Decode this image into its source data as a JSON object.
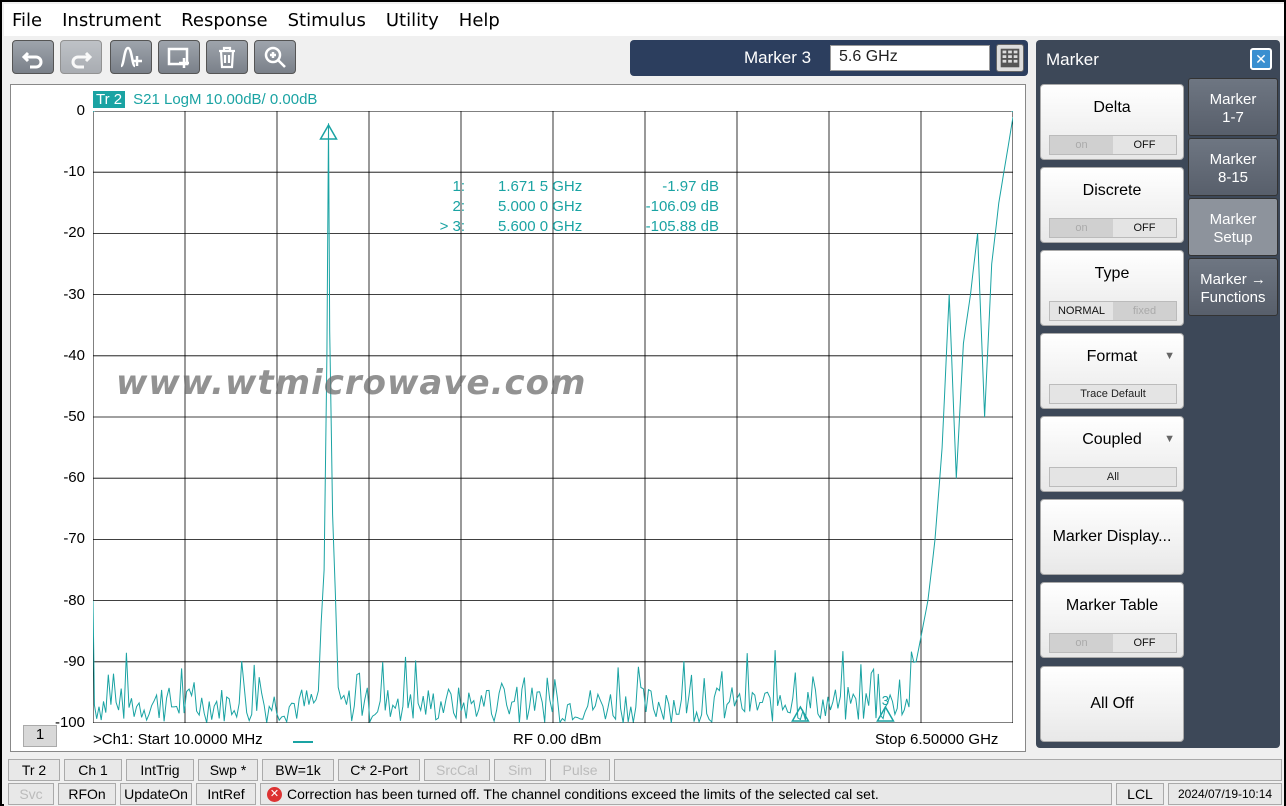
{
  "menu": [
    "File",
    "Instrument",
    "Response",
    "Stimulus",
    "Utility",
    "Help"
  ],
  "toolbar_icons": [
    "undo-icon",
    "redo-icon",
    "add-trace-icon",
    "channel-icon",
    "delete-icon",
    "zoom-icon"
  ],
  "marker_entry": {
    "label": "Marker 3",
    "value": "5.6 GHz"
  },
  "trace": {
    "name": "Tr 2",
    "desc": "S21 LogM 10.00dB/  0.00dB"
  },
  "watermark": "www.wtmicrowave.com",
  "marker_readouts": [
    {
      "id": "1:",
      "freq": "1.671 5 GHz",
      "val": "-1.97 dB"
    },
    {
      "id": "2:",
      "freq": "5.000 0 GHz",
      "val": "-106.09 dB"
    },
    {
      "id": "> 3:",
      "freq": "5.600 0 GHz",
      "val": "-105.88 dB"
    }
  ],
  "footer": {
    "channel": "1",
    "start": ">Ch1:  Start   10.0000 MHz",
    "rf": "RF    0.00 dBm",
    "stop": "Stop  6.50000 GHz"
  },
  "panel": {
    "title": "Marker",
    "buttons": [
      {
        "label": "Delta",
        "opts": [
          "on",
          "OFF"
        ]
      },
      {
        "label": "Discrete",
        "opts": [
          "on",
          "OFF"
        ]
      },
      {
        "label": "Type",
        "opts": [
          "NORMAL",
          "fixed"
        ]
      },
      {
        "label": "Format",
        "value": "Trace Default"
      },
      {
        "label": "Coupled",
        "value": "All"
      },
      {
        "label": "Marker Display..."
      },
      {
        "label": "Marker Table",
        "opts": [
          "on",
          "OFF"
        ]
      },
      {
        "label": "All Off"
      }
    ],
    "tabs": [
      "Marker\n1-7",
      "Marker\n8-15",
      "Marker\nSetup",
      "Marker →\nFunctions"
    ]
  },
  "status_row1": [
    "Tr 2",
    "Ch 1",
    "IntTrig",
    "Swp *",
    "BW=1k",
    "C* 2-Port",
    "SrcCal",
    "Sim",
    "Pulse"
  ],
  "status_row2": [
    "Svc",
    "RFOn",
    "UpdateOn",
    "IntRef"
  ],
  "status_message": "Correction has been turned off. The channel conditions exceed the limits of the selected cal set.",
  "status_right": [
    "LCL",
    "2024/07/19-10:14"
  ],
  "colors": {
    "trace": "#1aa3a3",
    "panel": "#3d4858"
  },
  "chart_data": {
    "type": "line",
    "xlabel": "",
    "ylabel": "",
    "xlim": [
      0.01,
      6.5
    ],
    "ylim": [
      -100,
      0
    ],
    "y_ticks": [
      0,
      -10,
      -20,
      -30,
      -40,
      -50,
      -60,
      -70,
      -80,
      -90,
      -100
    ],
    "grid": true,
    "series": [
      {
        "name": "S21",
        "x": [
          0.01,
          0.02,
          0.1,
          0.3,
          0.6,
          0.9,
          1.2,
          1.5,
          1.6,
          1.64,
          1.66,
          1.671,
          1.68,
          1.7,
          1.74,
          1.78,
          2.0,
          2.5,
          3.0,
          3.5,
          4.0,
          4.5,
          5.0,
          5.3,
          5.5,
          5.6,
          5.7,
          5.8,
          5.9,
          5.95,
          6.0,
          6.05,
          6.1,
          6.15,
          6.2,
          6.25,
          6.3,
          6.35,
          6.4,
          6.45,
          6.5
        ],
        "y": [
          -80,
          -96,
          -98,
          -99,
          -97,
          -99,
          -98,
          -98,
          -92,
          -75,
          -40,
          -2,
          -36,
          -66,
          -92,
          -99,
          -99,
          -98,
          -99,
          -98,
          -99,
          -98,
          -106,
          -99,
          -99,
          -106,
          -95,
          -92,
          -80,
          -70,
          -55,
          -30,
          -60,
          -38,
          -30,
          -20,
          -50,
          -25,
          -15,
          -8,
          -1
        ]
      }
    ],
    "markers": [
      {
        "id": "1",
        "x": 1.6715,
        "y": -1.97
      },
      {
        "id": "2",
        "x": 5.0,
        "y": -106.09
      },
      {
        "id": "3",
        "x": 5.6,
        "y": -105.88
      }
    ]
  }
}
